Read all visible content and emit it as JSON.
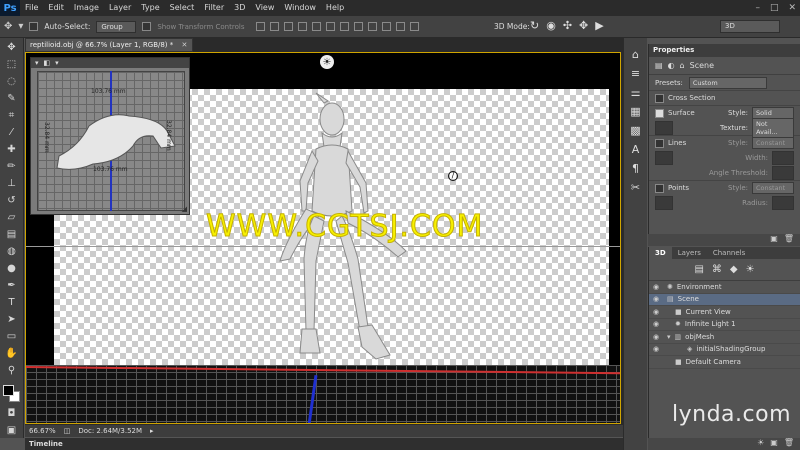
{
  "app": {
    "logo": "Ps",
    "menus": [
      "File",
      "Edit",
      "Image",
      "Layer",
      "Type",
      "Select",
      "Filter",
      "3D",
      "View",
      "Window",
      "Help"
    ],
    "window_controls": [
      "–",
      "□",
      "✕"
    ]
  },
  "options_bar": {
    "auto_select_label": "Auto-Select:",
    "auto_select_value": "Group",
    "transform_controls_label": "Show Transform Controls",
    "mode3d_label": "3D Mode:",
    "workspace_value": "3D"
  },
  "document": {
    "tab_title": "reptilioid.obj @ 66.7% (Layer 1, RGB/8) *",
    "watermark": "WWW.CGTSJ.COM",
    "inset_measures": [
      "103.76 mm",
      "32.84 mm",
      "103.76 mm",
      "32.84 mm"
    ]
  },
  "status": {
    "zoom": "66.67%",
    "doc_info": "Doc: 2.64M/3.52M",
    "timeline_label": "Timeline"
  },
  "properties": {
    "tab_label": "Properties",
    "header_label": "Scene",
    "presets_label": "Presets:",
    "presets_value": "Custom",
    "cross_section_label": "Cross Section",
    "surface_label": "Surface",
    "style_label": "Style:",
    "surface_style_value": "Solid",
    "texture_label": "Texture:",
    "texture_value": "Not Avail...",
    "lines_label": "Lines",
    "lines_style_value": "Constant",
    "width_label": "Width:",
    "angle_label": "Angle Threshold:",
    "points_label": "Points",
    "points_style_value": "Constant",
    "radius_label": "Radius:"
  },
  "panel3d": {
    "tabs": [
      "3D",
      "Layers",
      "Channels"
    ],
    "items": [
      {
        "label": "Environment",
        "indent": 0
      },
      {
        "label": "Scene",
        "indent": 0,
        "selected": true
      },
      {
        "label": "Current View",
        "indent": 1
      },
      {
        "label": "Infinite Light 1",
        "indent": 1
      },
      {
        "label": "objMesh",
        "indent": 1
      },
      {
        "label": "initialShadingGroup",
        "indent": 2
      },
      {
        "label": "Default Camera",
        "indent": 1
      }
    ]
  },
  "branding": {
    "lynda": "lynda.com"
  }
}
